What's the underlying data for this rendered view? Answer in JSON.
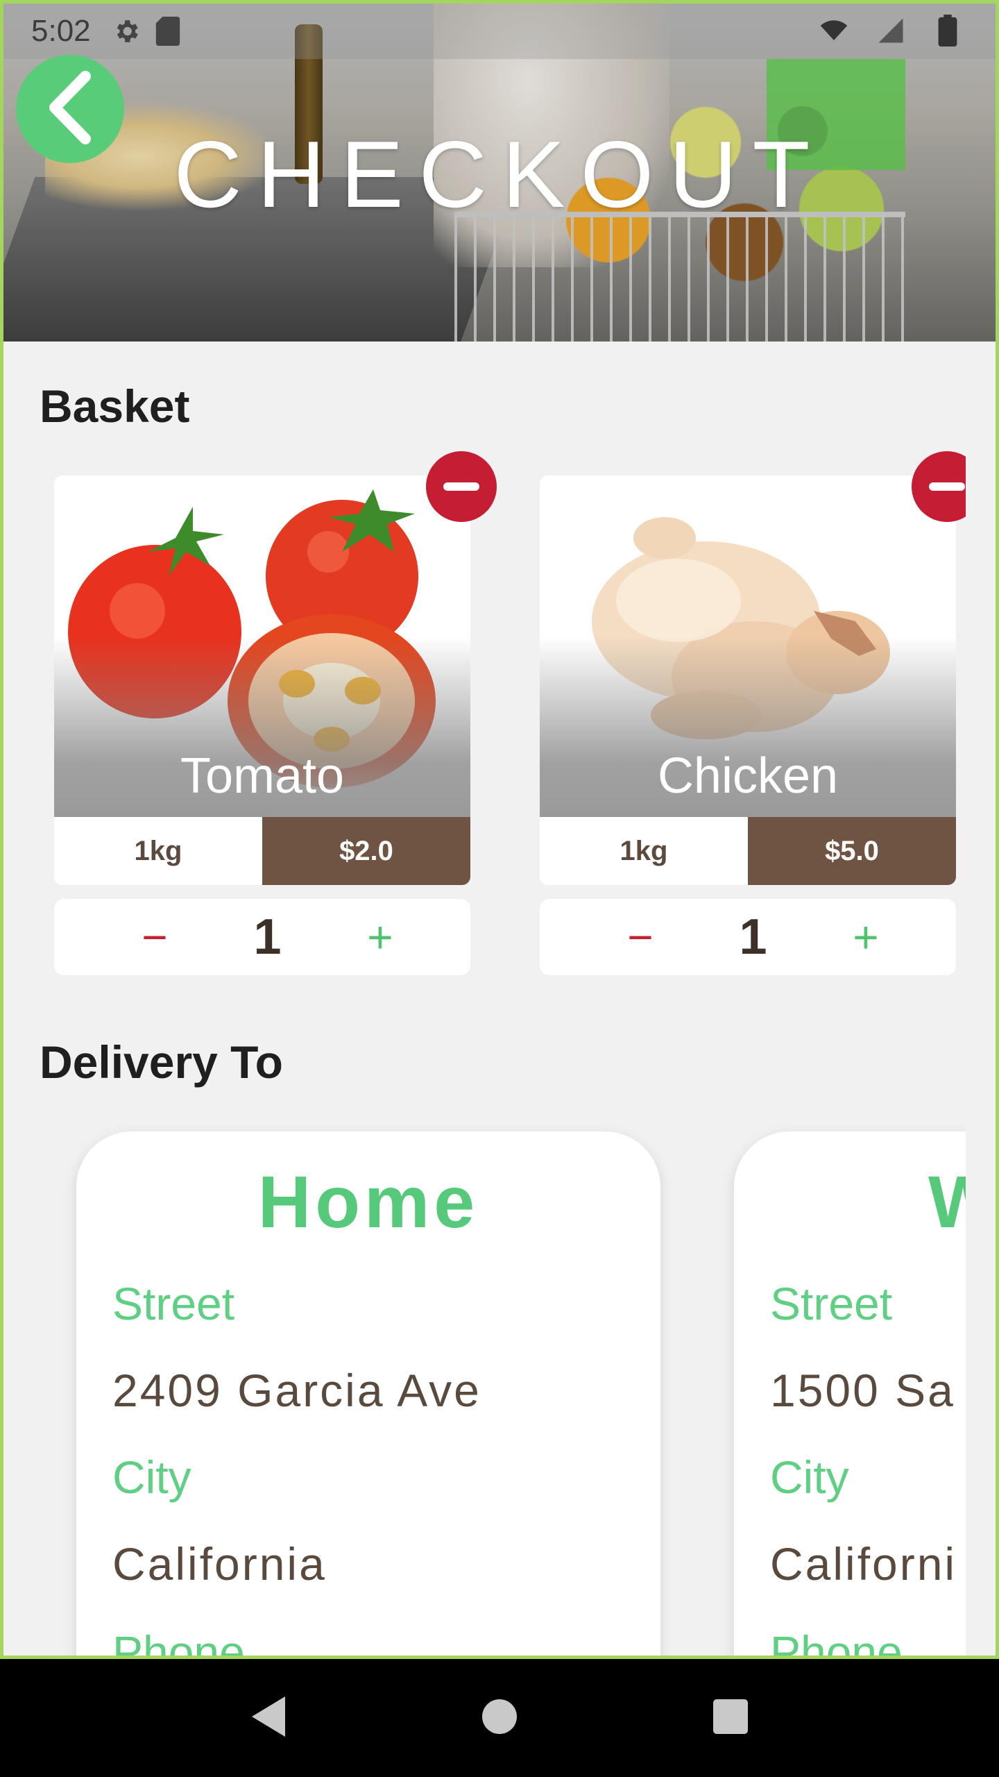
{
  "status_bar": {
    "time": "5:02",
    "icons": [
      "gear-icon",
      "sd-card-icon",
      "wifi-icon",
      "signal-icon",
      "battery-icon"
    ]
  },
  "header": {
    "title": "CHECKOUT",
    "back_icon": "chevron-left-icon"
  },
  "basket": {
    "title": "Basket",
    "items": [
      {
        "name": "Tomato",
        "weight": "1kg",
        "price": "$2.0",
        "quantity": "1",
        "minus": "−",
        "plus": "+"
      },
      {
        "name": "Chicken",
        "weight": "1kg",
        "price": "$5.0",
        "quantity": "1",
        "minus": "−",
        "plus": "+"
      }
    ]
  },
  "delivery": {
    "title": "Delivery To",
    "addresses": [
      {
        "title": "Home",
        "street_label": "Street",
        "street": "2409 Garcia Ave",
        "city_label": "City",
        "city": "California",
        "phone_label": "Phone"
      },
      {
        "title": "W",
        "street_label": "Street",
        "street": "1500 Sa",
        "city_label": "City",
        "city": "Californi",
        "phone_label": "Phone"
      }
    ]
  },
  "colors": {
    "accent_green": "#58cc79",
    "remove_red": "#c41d34",
    "price_brown": "#6f5444",
    "background": "#f1f1f1"
  },
  "nav": {
    "back": "nav-back-icon",
    "home": "nav-home-icon",
    "recents": "nav-recents-icon"
  }
}
